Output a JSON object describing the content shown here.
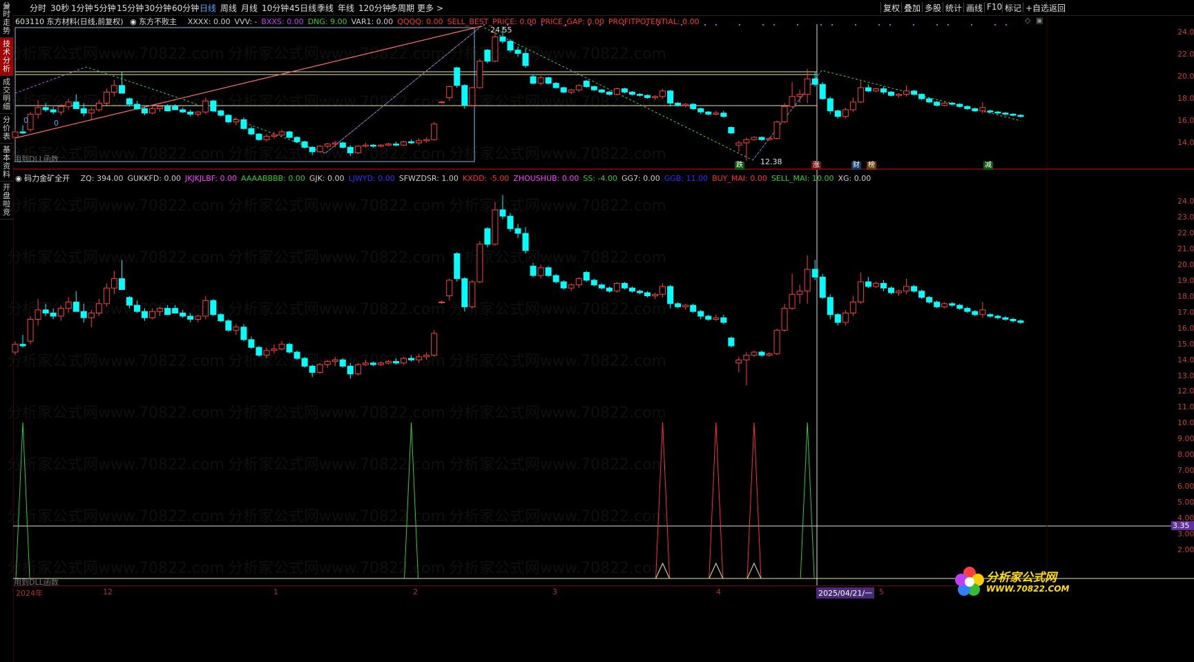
{
  "leftbar": [
    {
      "label": "分时走势",
      "active": false
    },
    {
      "label": "技术分析",
      "active": true
    },
    {
      "label": "成交明细",
      "active": false
    },
    {
      "label": "分价表",
      "active": false
    },
    {
      "label": "基本资料",
      "active": false
    },
    {
      "label": "开盘啦竞",
      "active": false
    }
  ],
  "toolbar": {
    "periods": [
      "分时",
      "30秒",
      "1分钟",
      "5分钟",
      "15分钟",
      "30分钟",
      "60分钟",
      "日线",
      "周线",
      "月线",
      "10分钟",
      "45日线",
      "季线",
      "年线",
      "120分钟",
      "多周期",
      "更多 >"
    ],
    "active_period": "日线",
    "right_tools": [
      "复权",
      "叠加",
      "多股",
      "统计",
      "画线",
      "F10",
      "标记",
      "+自选",
      "返回"
    ]
  },
  "top_indicator": {
    "stock": "603110 东方材料(日线,前复权)",
    "formula": "东方不败主",
    "items": [
      {
        "text": "XXXX: 0.00",
        "color": "#d0d0d0"
      },
      {
        "text": "VVV: -",
        "color": "#d0d0d0"
      },
      {
        "text": "BXXS: 0.00",
        "color": "#c040ff"
      },
      {
        "text": "DNG: 9.00",
        "color": "#30d030"
      },
      {
        "text": "VAR1: 0.00",
        "color": "#d0d0d0"
      },
      {
        "text": "QQQQ: 0.00",
        "color": "#ff3030"
      },
      {
        "text": "SELL_BEST_PRICE: 0.00",
        "color": "#ff3030"
      },
      {
        "text": "PRICE_GAP: 0.00",
        "color": "#ff3030"
      },
      {
        "text": "PROFITPOTENTIAL: 0.00",
        "color": "#ff3030"
      }
    ]
  },
  "bottom_indicator": {
    "formula": "码力金矿全开",
    "items": [
      {
        "text": "ZQ: 394.00",
        "color": "#d0d0d0"
      },
      {
        "text": "GUKKFD: 0.00",
        "color": "#d0d0d0"
      },
      {
        "text": "JKJKJLBF: 0.00",
        "color": "#ff40ff"
      },
      {
        "text": "AAAABBBB: 0.00",
        "color": "#30d030"
      },
      {
        "text": "GJK: 0.00",
        "color": "#d0d0d0"
      },
      {
        "text": "LJWYD: 0.00",
        "color": "#3030ff"
      },
      {
        "text": "SFWZDSR: 1.00",
        "color": "#d0d0d0"
      },
      {
        "text": "KXDD: -5.00",
        "color": "#ff3030"
      },
      {
        "text": "ZHOUSHUB: 0.00",
        "color": "#ff40ff"
      },
      {
        "text": "SS: -4.00",
        "color": "#30d030"
      },
      {
        "text": "GG7: 0.00",
        "color": "#d0d0d0"
      },
      {
        "text": "GGB: 11.00",
        "color": "#3030ff"
      },
      {
        "text": "BUY_MAI: 0.00",
        "color": "#ff3030"
      },
      {
        "text": "SELL_MAI: 10.00",
        "color": "#30d030"
      },
      {
        "text": "XG: 0.00",
        "color": "#d0d0d0"
      }
    ]
  },
  "top_axis": [
    "24.00",
    "22.00",
    "20.00",
    "18.00",
    "16.00",
    "14.00"
  ],
  "bottom_axis": [
    "24.00",
    "23.00",
    "22.00",
    "21.00",
    "20.00",
    "19.00",
    "18.00",
    "17.00",
    "16.00",
    "15.00",
    "14.00",
    "13.00",
    "12.00",
    "11.00",
    "10.00",
    "9.00",
    "8.00",
    "7.00",
    "6.00",
    "5.00",
    "4.00",
    "3.00",
    "2.00"
  ],
  "bottom_marker": "3.35",
  "price_labels": {
    "high": "24.55",
    "low": "12.38"
  },
  "dll_label": "用到DLL函数",
  "zero_labels": [
    "0",
    "0"
  ],
  "tags": [
    {
      "text": "跌",
      "color": "#30d030"
    },
    {
      "text": "涨",
      "color": "#ff3030"
    },
    {
      "text": "财",
      "color": "#4aa8ff"
    },
    {
      "text": "榜",
      "color": "#ff9030"
    },
    {
      "text": "减",
      "color": "#30d030"
    }
  ],
  "xaxis": [
    "2024年",
    "12",
    "1",
    "2",
    "3",
    "4",
    "2025/04/21/一",
    "5"
  ],
  "logo": {
    "text": "分析家公式网",
    "url": "WWW.70822.COM"
  },
  "watermark": "分析家公式网www.70822.com",
  "chart_data": {
    "type": "candlestick",
    "title": "603110 东方材料(日线,前复权)",
    "price_high": 24.55,
    "price_low": 12.38,
    "candles": [
      [
        14.5,
        15.2,
        14.3,
        15.0
      ],
      [
        15.0,
        15.6,
        14.8,
        14.9
      ],
      [
        15.2,
        16.8,
        15.0,
        16.6
      ],
      [
        16.6,
        17.9,
        16.2,
        17.2
      ],
      [
        17.2,
        17.6,
        16.8,
        17.0
      ],
      [
        17.0,
        17.3,
        16.6,
        16.8
      ],
      [
        16.8,
        17.5,
        16.5,
        17.3
      ],
      [
        17.3,
        18.0,
        17.0,
        17.7
      ],
      [
        17.7,
        18.4,
        17.3,
        17.1
      ],
      [
        17.1,
        17.6,
        16.4,
        16.7
      ],
      [
        16.7,
        17.2,
        16.1,
        17.0
      ],
      [
        17.0,
        17.9,
        16.8,
        17.6
      ],
      [
        17.6,
        18.9,
        17.4,
        18.6
      ],
      [
        18.6,
        19.7,
        18.2,
        19.2
      ],
      [
        19.2,
        20.4,
        18.8,
        18.5
      ],
      [
        18.0,
        18.1,
        17.3,
        17.5
      ],
      [
        17.5,
        17.8,
        17.0,
        17.1
      ],
      [
        17.1,
        17.3,
        16.5,
        16.7
      ],
      [
        16.7,
        17.3,
        16.6,
        17.1
      ],
      [
        17.1,
        17.4,
        16.8,
        17.3
      ],
      [
        17.3,
        17.5,
        16.9,
        16.9
      ],
      [
        17.3,
        17.5,
        17.0,
        17.0
      ],
      [
        17.0,
        17.2,
        16.7,
        16.8
      ],
      [
        16.8,
        17.0,
        16.4,
        16.6
      ],
      [
        16.6,
        16.9,
        16.4,
        16.8
      ],
      [
        16.8,
        18.1,
        16.6,
        17.8
      ],
      [
        17.8,
        17.9,
        16.8,
        16.9
      ],
      [
        16.9,
        17.0,
        16.4,
        16.5
      ],
      [
        16.5,
        16.6,
        15.8,
        15.9
      ],
      [
        15.9,
        16.3,
        15.6,
        16.1
      ],
      [
        16.1,
        16.3,
        15.2,
        15.3
      ],
      [
        15.3,
        15.5,
        14.7,
        14.8
      ],
      [
        14.8,
        14.9,
        14.2,
        14.3
      ],
      [
        14.3,
        14.8,
        14.1,
        14.6
      ],
      [
        14.6,
        15.0,
        14.4,
        14.7
      ],
      [
        14.7,
        15.2,
        14.6,
        15.0
      ],
      [
        15.0,
        15.1,
        14.4,
        14.5
      ],
      [
        14.5,
        14.6,
        14.0,
        14.1
      ],
      [
        14.1,
        14.2,
        13.5,
        13.6
      ],
      [
        13.6,
        13.7,
        12.9,
        13.2
      ],
      [
        13.2,
        13.8,
        13.1,
        13.7
      ],
      [
        13.7,
        14.0,
        13.5,
        13.9
      ],
      [
        13.9,
        14.2,
        13.6,
        14.0
      ],
      [
        14.0,
        14.1,
        13.5,
        13.6
      ],
      [
        13.6,
        13.8,
        12.8,
        13.1
      ],
      [
        13.1,
        13.8,
        13.0,
        13.7
      ],
      [
        13.7,
        14.0,
        13.6,
        13.8
      ],
      [
        13.8,
        13.9,
        13.6,
        13.7
      ],
      [
        13.7,
        13.9,
        13.6,
        13.8
      ],
      [
        13.8,
        14.0,
        13.7,
        13.9
      ],
      [
        13.9,
        14.1,
        13.7,
        13.8
      ],
      [
        13.8,
        14.2,
        13.7,
        14.1
      ],
      [
        14.1,
        14.3,
        13.9,
        14.0
      ],
      [
        14.0,
        14.4,
        13.8,
        14.2
      ],
      [
        14.2,
        14.5,
        14.0,
        14.3
      ],
      [
        14.3,
        15.9,
        14.2,
        15.7
      ],
      [
        17.7,
        17.8,
        17.6,
        17.7
      ],
      [
        18.1,
        19.2,
        17.8,
        19.1
      ],
      [
        20.8,
        20.9,
        19.0,
        19.2
      ],
      [
        19.2,
        19.3,
        17.1,
        17.4
      ],
      [
        17.4,
        19.1,
        17.3,
        19.0
      ],
      [
        19.0,
        21.6,
        18.9,
        21.4
      ],
      [
        22.4,
        22.5,
        21.2,
        21.4
      ],
      [
        21.4,
        24.1,
        21.3,
        23.6
      ],
      [
        23.6,
        24.55,
        23.0,
        23.2
      ],
      [
        23.2,
        23.4,
        22.2,
        22.4
      ],
      [
        22.4,
        22.7,
        21.8,
        22.1
      ],
      [
        22.1,
        22.5,
        20.8,
        21.0
      ],
      [
        20.0,
        20.2,
        19.3,
        19.4
      ],
      [
        19.4,
        20.1,
        19.2,
        19.9
      ],
      [
        19.9,
        20.0,
        19.3,
        19.4
      ],
      [
        19.4,
        19.5,
        18.9,
        19.0
      ],
      [
        19.0,
        19.1,
        18.5,
        18.6
      ],
      [
        18.6,
        18.9,
        18.4,
        18.8
      ],
      [
        18.8,
        19.3,
        18.6,
        19.2
      ],
      [
        19.6,
        19.7,
        19.0,
        19.1
      ],
      [
        19.1,
        19.2,
        18.7,
        18.8
      ],
      [
        18.8,
        18.9,
        18.5,
        18.6
      ],
      [
        18.6,
        18.7,
        18.3,
        18.4
      ],
      [
        18.4,
        19.0,
        18.3,
        18.9
      ],
      [
        18.9,
        19.0,
        18.5,
        18.6
      ],
      [
        18.6,
        18.7,
        18.3,
        18.4
      ],
      [
        18.4,
        18.5,
        18.2,
        18.3
      ],
      [
        18.3,
        18.4,
        18.0,
        18.1
      ],
      [
        18.1,
        18.3,
        17.9,
        18.2
      ],
      [
        18.2,
        18.9,
        18.0,
        18.7
      ],
      [
        18.7,
        18.8,
        17.3,
        17.6
      ],
      [
        17.6,
        17.7,
        17.3,
        17.4
      ],
      [
        17.4,
        17.6,
        17.2,
        17.5
      ],
      [
        17.5,
        17.6,
        17.0,
        17.1
      ],
      [
        17.1,
        17.2,
        16.6,
        16.8
      ],
      [
        16.8,
        16.9,
        16.5,
        16.6
      ],
      [
        16.6,
        16.9,
        16.5,
        16.7
      ],
      [
        16.7,
        16.9,
        16.3,
        16.4
      ],
      [
        15.4,
        15.5,
        14.8,
        14.9
      ],
      [
        13.8,
        14.2,
        13.2,
        14.0
      ],
      [
        14.0,
        14.5,
        12.38,
        14.3
      ],
      [
        14.3,
        14.6,
        14.2,
        14.5
      ],
      [
        14.5,
        14.6,
        14.2,
        14.3
      ],
      [
        14.3,
        14.5,
        14.2,
        14.4
      ],
      [
        14.4,
        16.0,
        14.3,
        15.9
      ],
      [
        15.9,
        17.6,
        15.8,
        17.3
      ],
      [
        17.3,
        19.5,
        17.2,
        18.2
      ],
      [
        18.2,
        18.8,
        17.6,
        18.4
      ],
      [
        18.4,
        20.7,
        17.6,
        19.8
      ],
      [
        19.8,
        20.4,
        19.1,
        19.3
      ],
      [
        19.3,
        19.5,
        17.9,
        18.0
      ],
      [
        18.0,
        18.2,
        16.6,
        16.9
      ],
      [
        16.9,
        17.0,
        16.2,
        16.4
      ],
      [
        16.4,
        17.2,
        16.2,
        17.0
      ],
      [
        17.0,
        18.1,
        16.8,
        17.7
      ],
      [
        17.7,
        19.6,
        17.6,
        19.0
      ],
      [
        19.0,
        19.3,
        18.6,
        18.7
      ],
      [
        18.7,
        19.0,
        18.6,
        18.9
      ],
      [
        18.9,
        19.1,
        18.4,
        18.6
      ],
      [
        18.6,
        18.7,
        18.2,
        18.3
      ],
      [
        18.3,
        18.5,
        18.1,
        18.4
      ],
      [
        18.4,
        19.2,
        18.2,
        18.7
      ],
      [
        18.7,
        18.8,
        18.3,
        18.4
      ],
      [
        18.4,
        18.5,
        17.9,
        18.0
      ],
      [
        18.0,
        18.1,
        17.6,
        17.7
      ],
      [
        17.7,
        17.8,
        17.3,
        17.4
      ],
      [
        17.4,
        17.7,
        17.3,
        17.6
      ],
      [
        17.6,
        17.7,
        17.4,
        17.5
      ],
      [
        17.5,
        17.6,
        17.2,
        17.3
      ],
      [
        17.3,
        17.4,
        17.0,
        17.1
      ],
      [
        17.1,
        17.2,
        16.8,
        16.9
      ],
      [
        16.9,
        17.7,
        16.7,
        17.2
      ],
      [
        16.9,
        17.0,
        16.7,
        16.8
      ],
      [
        16.8,
        16.9,
        16.6,
        16.7
      ],
      [
        16.7,
        16.8,
        16.5,
        16.6
      ],
      [
        16.6,
        16.7,
        16.4,
        16.5
      ],
      [
        16.5,
        16.6,
        16.3,
        16.4
      ]
    ],
    "bottom_signal_series": [
      {
        "name": "SELL_MAI",
        "color": "#30d030",
        "peaks": [
          1,
          52,
          104
        ]
      },
      {
        "name": "BUY_MAI",
        "color": "#ff3030",
        "peaks": [
          85,
          92,
          97
        ]
      }
    ]
  }
}
